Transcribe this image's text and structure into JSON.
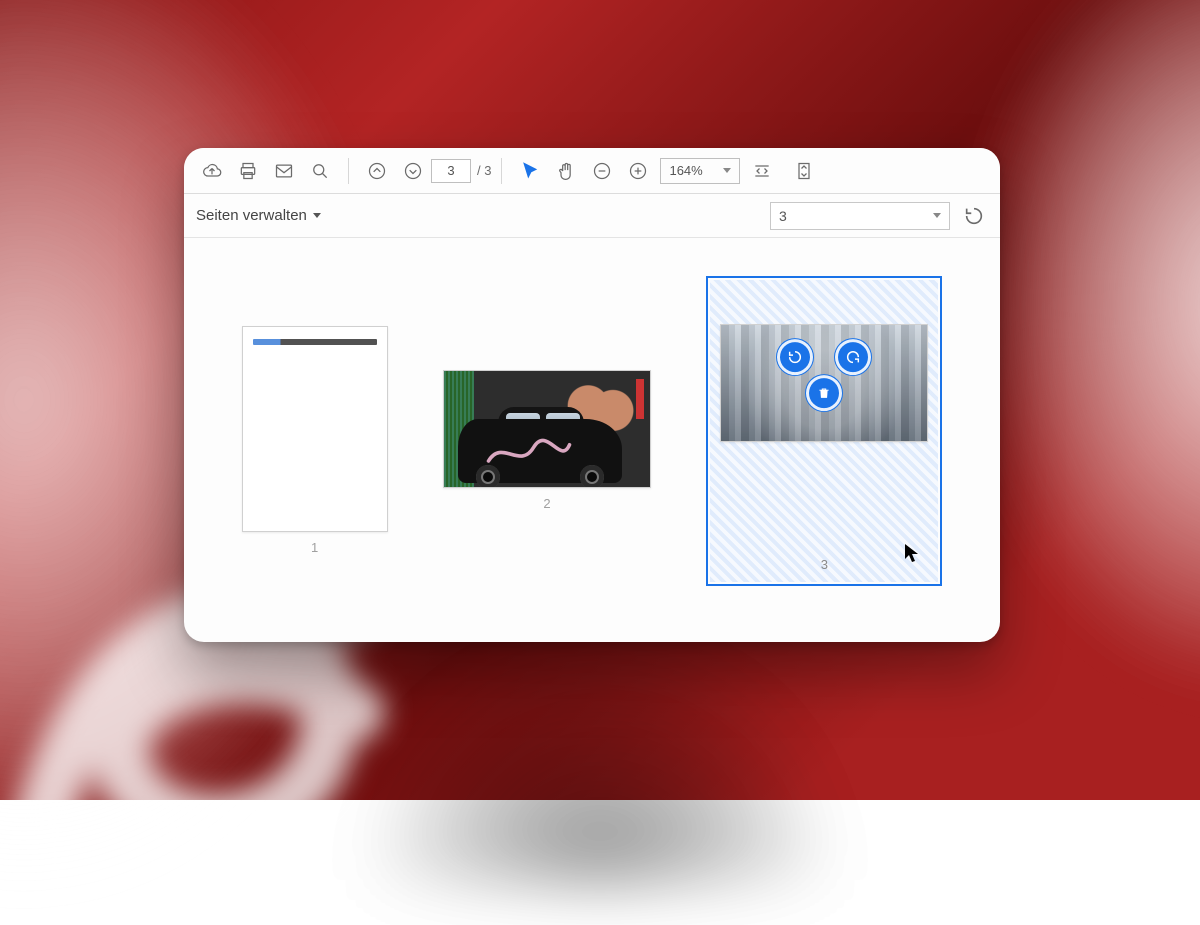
{
  "toolbar": {
    "current_page": "3",
    "page_total": "/ 3",
    "zoom": "164%"
  },
  "subbar": {
    "manage_label": "Seiten verwalten",
    "select_value": "3"
  },
  "thumbs": {
    "p1_label": "1",
    "p2_label": "2",
    "p3_label": "3"
  }
}
